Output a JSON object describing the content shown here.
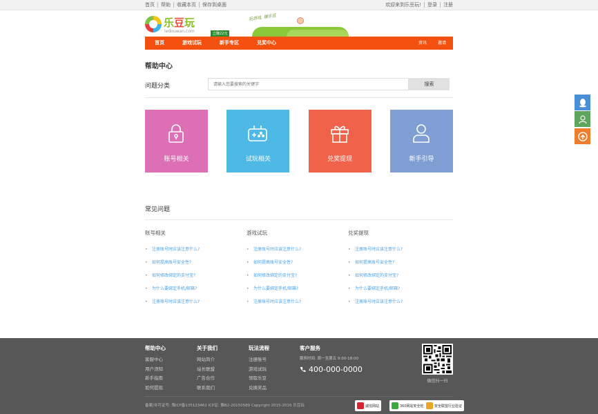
{
  "topbar": {
    "links": [
      "首页",
      "帮助",
      "收藏本页",
      "保存到桌面"
    ],
    "welcome": "欢迎来到乐豆玩!",
    "login": "登录",
    "register": "注册"
  },
  "logo": {
    "name_a": "乐",
    "name_b": "豆",
    "name_c": "玩",
    "domain": "ledouwan.com"
  },
  "banner": {
    "slogan": "玩游戏, 赚乐豆",
    "tag": "立赚22元"
  },
  "nav": {
    "items": [
      "首页",
      "游戏试玩",
      "新手专区",
      "兑奖中心"
    ],
    "right": [
      "资讯",
      "邀请"
    ]
  },
  "page_title": "帮助中心",
  "category_label": "问题分类",
  "search": {
    "placeholder": "请输入您要搜索的关键字",
    "button": "搜索"
  },
  "tiles": [
    {
      "label": "账号相关",
      "color": "#dd6fb5",
      "icon": "lock-icon"
    },
    {
      "label": "试玩相关",
      "color": "#4fb9e6",
      "icon": "gamepad-icon"
    },
    {
      "label": "兑奖提现",
      "color": "#f0634a",
      "icon": "gift-icon"
    },
    {
      "label": "新手引导",
      "color": "#7f9fd4",
      "icon": "user-icon"
    }
  ],
  "faq": {
    "title": "常见问题",
    "columns": [
      {
        "heading": "账号相关",
        "items": [
          "注册账号时应该注意什么?",
          "如何提高账号安全性?",
          "如何修改绑定的支付宝?",
          "为什么要绑定手机/邮箱?",
          "注册账号时应该注意什么?"
        ]
      },
      {
        "heading": "游戏试玩",
        "items": [
          "注册账号时应该注意什么?",
          "如何提高账号安全性?",
          "如何修改绑定的支付宝?",
          "为什么要绑定手机/邮箱?",
          "注册账号时应该注意什么?"
        ]
      },
      {
        "heading": "兑奖提现",
        "items": [
          "注册账号时应该注意什么?",
          "如何提高账号安全性?",
          "如何修改绑定的支付宝?",
          "为什么要绑定手机/邮箱?",
          "注册账号时应该注意什么?"
        ]
      }
    ]
  },
  "sidebar": [
    {
      "icon": "qq-icon",
      "color": "#4a90d9"
    },
    {
      "icon": "contact-icon",
      "color": "#5da55d"
    },
    {
      "icon": "arrow-up-icon",
      "color": "#f07d2c"
    }
  ],
  "footer": {
    "columns": [
      {
        "heading": "帮助中心",
        "links": [
          "客服中心",
          "用户须知",
          "新手指南",
          "如何提现"
        ]
      },
      {
        "heading": "关于我们",
        "links": [
          "网站简介",
          "站长联盟",
          "广告合作",
          "联系我们"
        ]
      },
      {
        "heading": "玩法流程",
        "links": [
          "注册账号",
          "游戏试玩",
          "领取乐豆",
          "兑换奖品"
        ]
      }
    ],
    "service": {
      "heading": "客户服务",
      "time": "服务时间: 周一至周五 9:00-18:00",
      "phone": "400-000-0000"
    },
    "qr_caption": "微信扫一扫",
    "copyright": "备案/许可证号: 豫ICP备135123462 ICP证: 豫B2-20150589 Copyright 2015-2016 乐豆玩",
    "badges": [
      "诚信网站",
      "360网站安全检测",
      "安全联盟行业验证"
    ]
  }
}
